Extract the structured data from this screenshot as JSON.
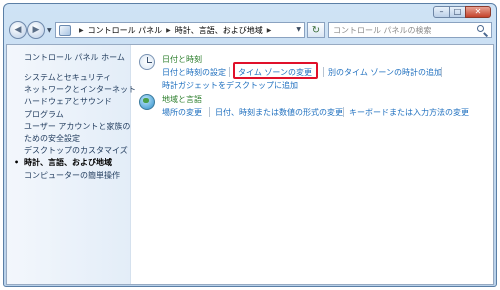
{
  "window": {
    "controls": {
      "minimize": "–",
      "maximize": "□",
      "close": "✕"
    }
  },
  "navbar": {
    "back_icon": "back-arrow-icon",
    "forward_icon": "forward-arrow-icon",
    "breadcrumb": [
      "コントロール パネル",
      "時計、言語、および地域"
    ],
    "separator": "▶",
    "search_placeholder": "コントロール パネルの検索"
  },
  "sidebar": {
    "home_label": "コントロール パネル ホーム",
    "items": [
      {
        "label": "システムとセキュリティ"
      },
      {
        "label": "ネットワークとインターネット"
      },
      {
        "label": "ハードウェアとサウンド"
      },
      {
        "label": "プログラム"
      },
      {
        "label": "ユーザー アカウントと家族の"
      },
      {
        "label": "ための安全設定"
      },
      {
        "label": "デスクトップのカスタマイズ"
      },
      {
        "label": "時計、言語、および地域"
      },
      {
        "label": "コンピューターの簡単操作"
      }
    ]
  },
  "categories": [
    {
      "title": "日付と時刻",
      "icon": "clock-icon",
      "links": [
        "日付と時刻の設定",
        "タイム ゾーンの変更",
        "別のタイム ゾーンの時計の追加",
        "時計ガジェットをデスクトップに追加"
      ]
    },
    {
      "title": "地域と言語",
      "icon": "globe-icon",
      "links": [
        "場所の変更",
        "日付、時刻または数値の形式の変更",
        "キーボードまたは入力方法の変更"
      ]
    }
  ],
  "colors": {
    "highlight": "#e0102a",
    "link": "#1e6fbf",
    "category_title": "#2a7d2a"
  }
}
